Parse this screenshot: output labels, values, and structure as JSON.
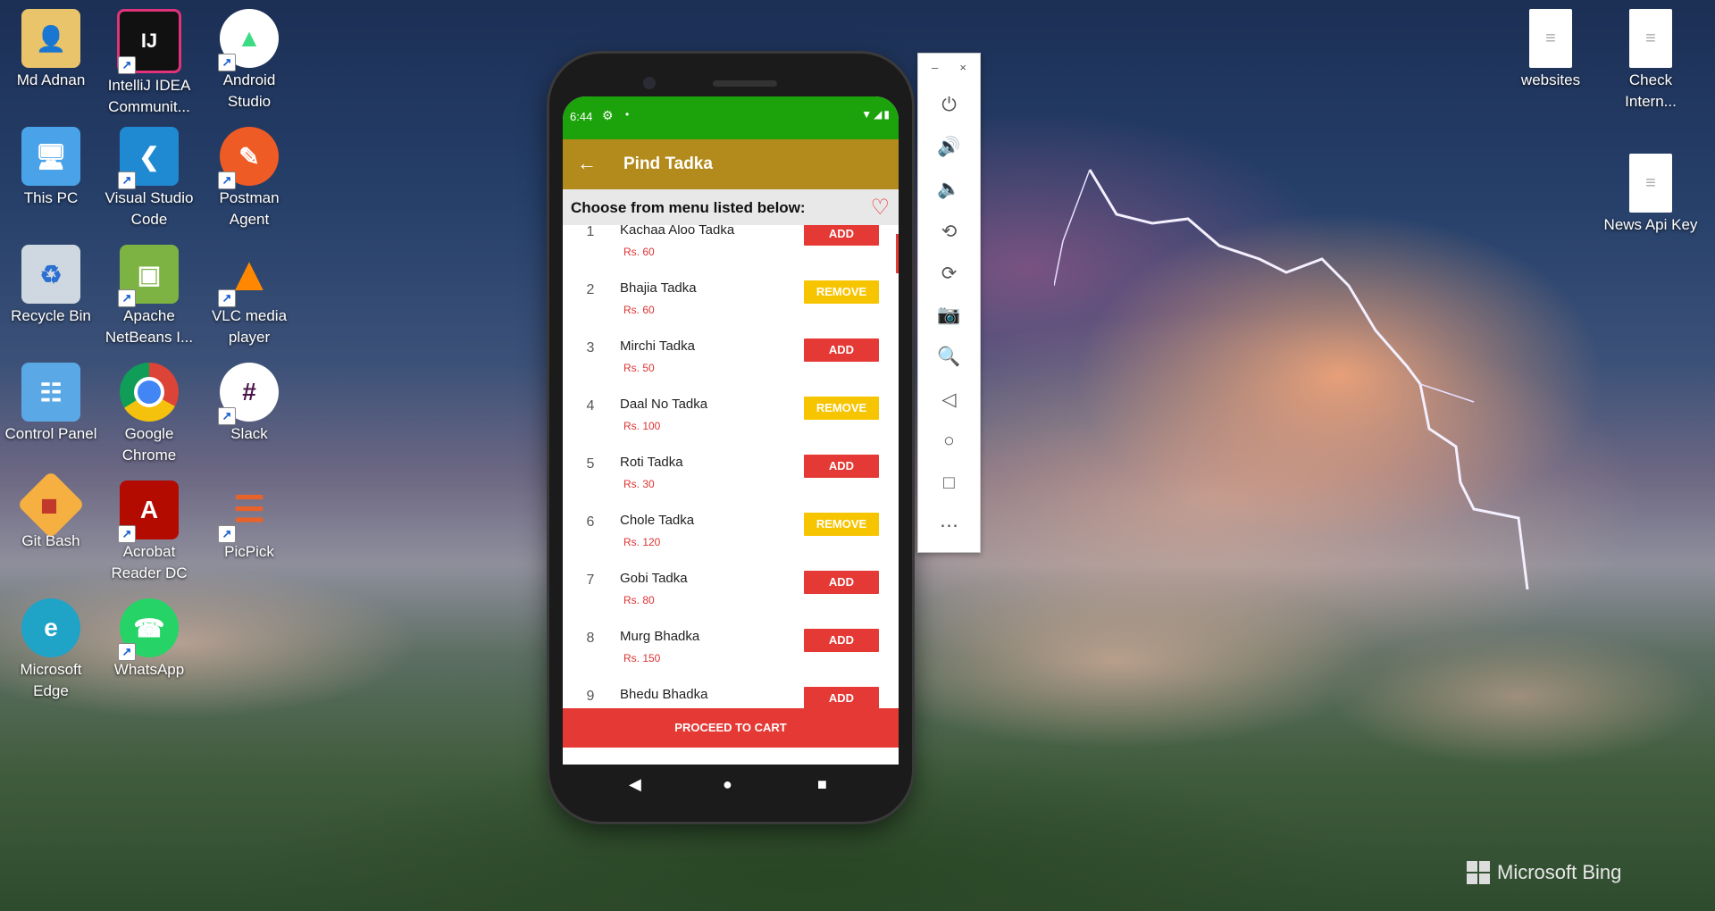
{
  "desktop": {
    "icons": [
      {
        "label": "Md Adnan",
        "icon": "user-folder-icon"
      },
      {
        "label": "IntelliJ IDEA Communit...",
        "icon": "intellij-icon"
      },
      {
        "label": "Android Studio",
        "icon": "android-studio-icon"
      },
      {
        "label": "This PC",
        "icon": "computer-icon"
      },
      {
        "label": "Visual Studio Code",
        "icon": "vscode-icon"
      },
      {
        "label": "Postman Agent",
        "icon": "postman-icon"
      },
      {
        "label": "Recycle Bin",
        "icon": "recycle-bin-icon"
      },
      {
        "label": "Apache NetBeans I...",
        "icon": "netbeans-icon"
      },
      {
        "label": "VLC media player",
        "icon": "vlc-icon"
      },
      {
        "label": "Control Panel",
        "icon": "control-panel-icon"
      },
      {
        "label": "Google Chrome",
        "icon": "chrome-icon"
      },
      {
        "label": "Slack",
        "icon": "slack-icon"
      },
      {
        "label": "Git Bash",
        "icon": "git-bash-icon"
      },
      {
        "label": "Acrobat Reader DC",
        "icon": "acrobat-icon"
      },
      {
        "label": "PicPick",
        "icon": "picpick-icon"
      },
      {
        "label": "Microsoft Edge",
        "icon": "edge-icon"
      },
      {
        "label": "WhatsApp",
        "icon": "whatsapp-icon"
      },
      {
        "label": "websites",
        "icon": "text-file-icon"
      },
      {
        "label": "Check Intern...",
        "icon": "text-file-icon"
      },
      {
        "label": "News Api Key",
        "icon": "text-file-icon"
      }
    ],
    "watermark": "Microsoft Bing"
  },
  "phone": {
    "status_time": "6:44",
    "app_title": "Pind Tadka",
    "subheader": "Choose from menu listed below:",
    "menu": [
      {
        "num": "1",
        "name": "Kachaa Aloo Tadka",
        "price": "Rs. 60",
        "action": "ADD"
      },
      {
        "num": "2",
        "name": "Bhajia Tadka",
        "price": "Rs. 60",
        "action": "REMOVE"
      },
      {
        "num": "3",
        "name": "Mirchi Tadka",
        "price": "Rs. 50",
        "action": "ADD"
      },
      {
        "num": "4",
        "name": "Daal No Tadka",
        "price": "Rs. 100",
        "action": "REMOVE"
      },
      {
        "num": "5",
        "name": "Roti Tadka",
        "price": "Rs. 30",
        "action": "ADD"
      },
      {
        "num": "6",
        "name": "Chole Tadka",
        "price": "Rs. 120",
        "action": "REMOVE"
      },
      {
        "num": "7",
        "name": "Gobi Tadka",
        "price": "Rs. 80",
        "action": "ADD"
      },
      {
        "num": "8",
        "name": "Murg Bhadka",
        "price": "Rs. 150",
        "action": "ADD"
      },
      {
        "num": "9",
        "name": "Bhedu Bhadka",
        "price": "",
        "action": "ADD"
      }
    ],
    "cart_button": "PROCEED TO CART"
  },
  "colors": {
    "status_bar": "#1ca30c",
    "app_bar": "#b38b1c",
    "add_button": "#e53935",
    "remove_button": "#f7c400"
  }
}
